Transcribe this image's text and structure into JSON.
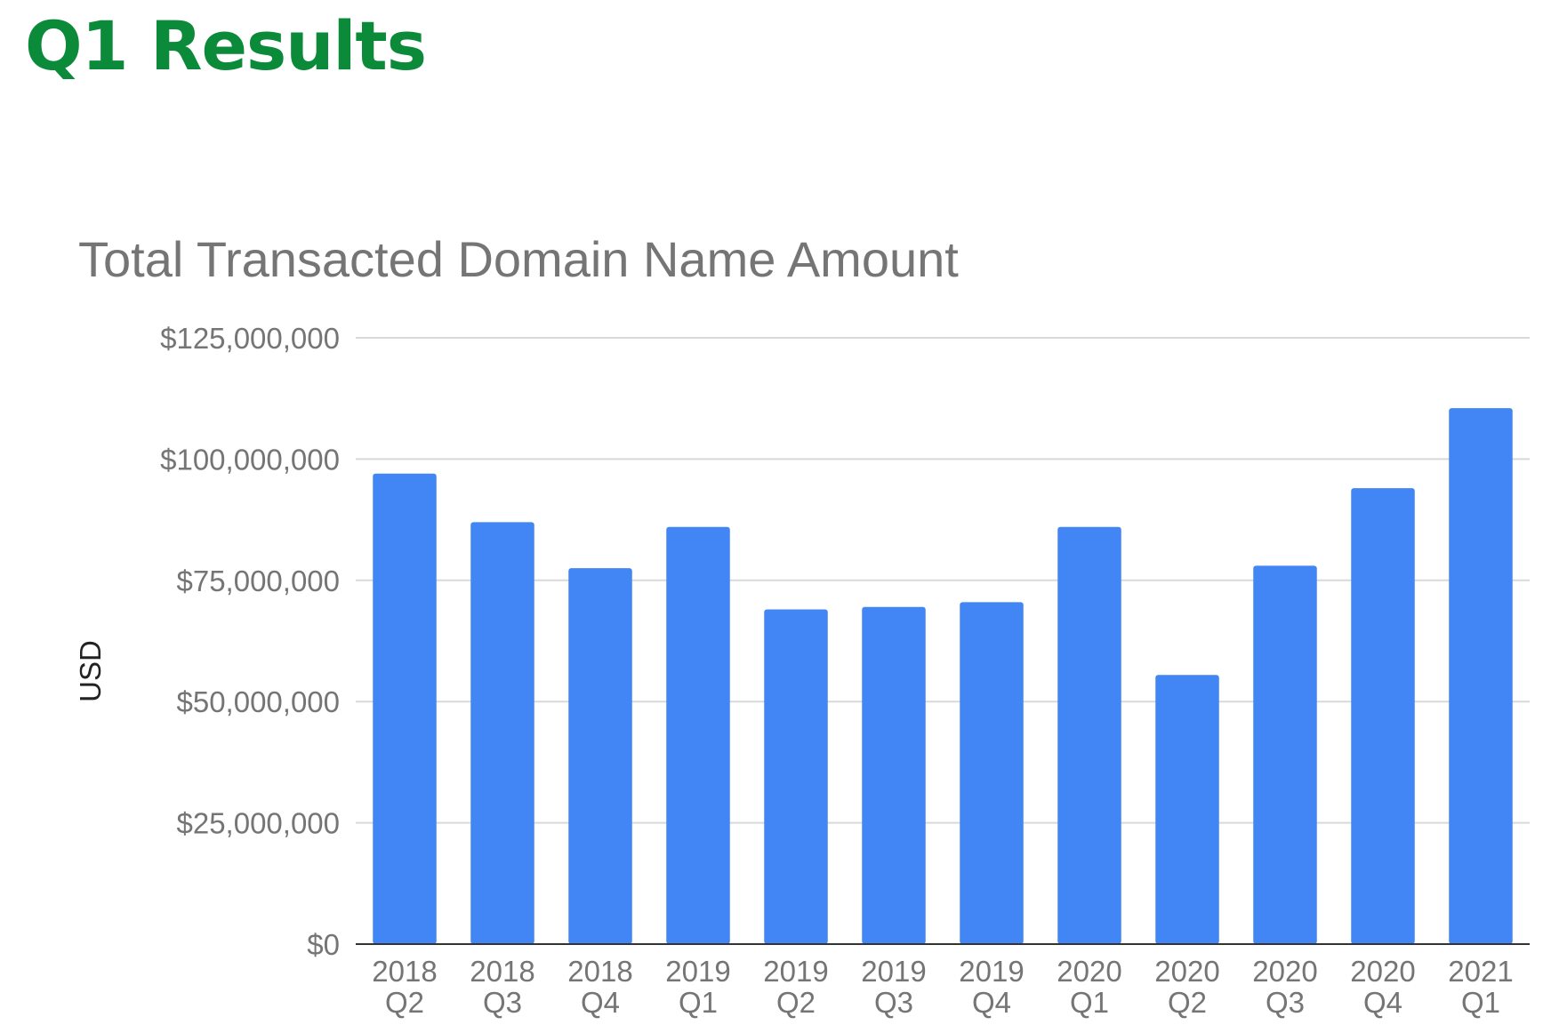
{
  "page": {
    "heading": "Q1 Results",
    "heading_color": "#0b8a3a"
  },
  "chart_data": {
    "type": "bar",
    "title": "Total Transacted Domain Name Amount",
    "xlabel": "",
    "ylabel": "USD",
    "ylim": [
      0,
      125000000
    ],
    "yticks": [
      0,
      25000000,
      50000000,
      75000000,
      100000000,
      125000000
    ],
    "ytick_labels": [
      "$0",
      "$25,000,000",
      "$50,000,000",
      "$75,000,000",
      "$100,000,000",
      "$125,000,000"
    ],
    "categories": [
      [
        "2018",
        "Q2"
      ],
      [
        "2018",
        "Q3"
      ],
      [
        "2018",
        "Q4"
      ],
      [
        "2019",
        "Q1"
      ],
      [
        "2019",
        "Q2"
      ],
      [
        "2019",
        "Q3"
      ],
      [
        "2019",
        "Q4"
      ],
      [
        "2020",
        "Q1"
      ],
      [
        "2020",
        "Q2"
      ],
      [
        "2020",
        "Q3"
      ],
      [
        "2020",
        "Q4"
      ],
      [
        "2021",
        "Q1"
      ]
    ],
    "values": [
      97000000,
      87000000,
      77500000,
      86000000,
      69000000,
      69500000,
      70500000,
      86000000,
      55500000,
      78000000,
      94000000,
      110500000
    ],
    "bar_color": "#4285f4",
    "grid": true,
    "legend": "none"
  }
}
